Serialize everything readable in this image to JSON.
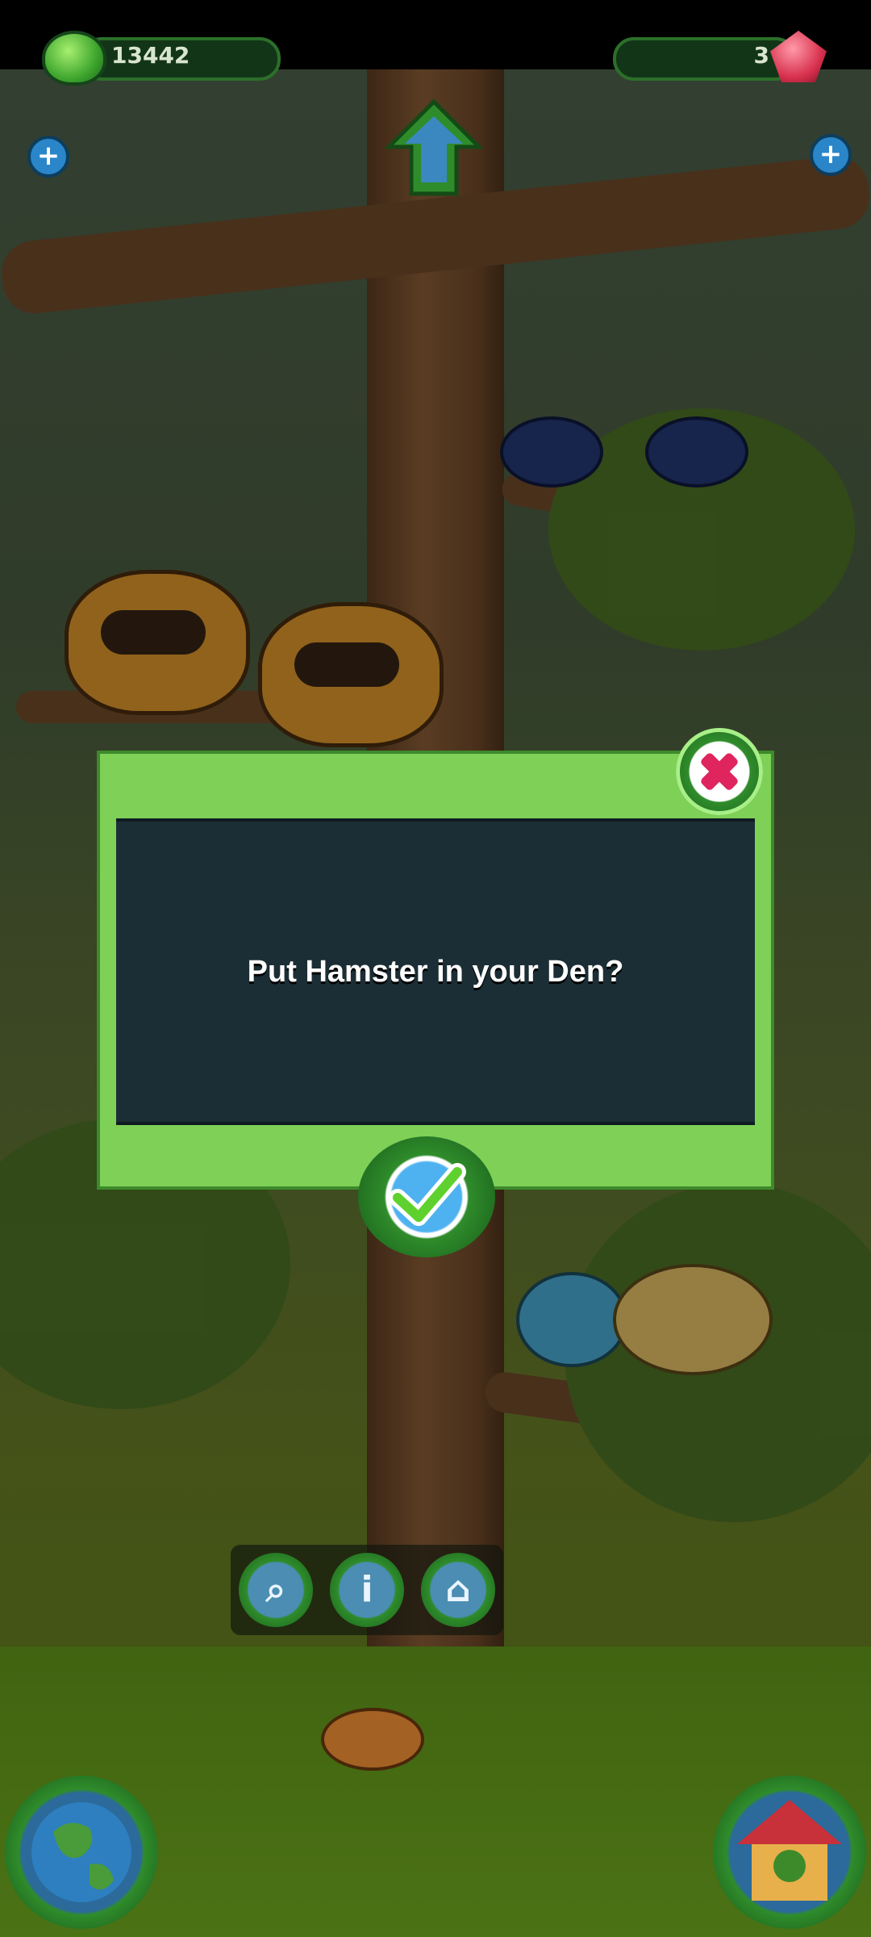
{
  "hud": {
    "coins": "13442",
    "gems": "3"
  },
  "dialog": {
    "message": "Put Hamster in your Den?"
  },
  "actionbar": {
    "buttons": [
      {
        "icon": "net-icon"
      },
      {
        "icon": "info-icon"
      },
      {
        "icon": "den-icon"
      }
    ]
  },
  "corner_buttons": {
    "left_icon": "globe-icon",
    "right_icon": "house-icon"
  },
  "colors": {
    "dialog_green": "#7ed057",
    "dialog_panel": "#1b2e35",
    "close_pink": "#e0245e",
    "confirm_blue": "#4fb2f0"
  }
}
